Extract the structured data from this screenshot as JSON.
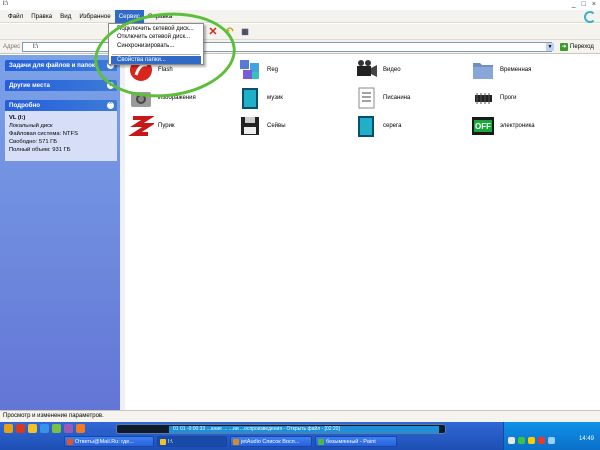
{
  "window": {
    "title": "I:\\"
  },
  "menu": {
    "items": [
      "Файл",
      "Правка",
      "Вид",
      "Избранное",
      "Сервис",
      "Справка"
    ],
    "active": "Сервис"
  },
  "dropdown": {
    "items": [
      "Подключить сетевой диск...",
      "Отключить сетевой диск...",
      "Синхронизировать..."
    ],
    "selected": "Свойства папки..."
  },
  "address": {
    "label": "Адрес",
    "value": "I:\\",
    "go_label": "Переход"
  },
  "left_pane": {
    "sections": [
      {
        "title": "Задачи для файлов и папок"
      },
      {
        "title": "Другие места"
      },
      {
        "title": "Подробно"
      }
    ],
    "details": {
      "drive": "VL (I:)",
      "type": "Локальный диск",
      "fs": "Файловая система: NTFS",
      "free": "Свободно: 571 ГБ",
      "total": "Полный объем: 931 ГБ"
    }
  },
  "folders": [
    {
      "name": "Flash",
      "icon": "flash-icon"
    },
    {
      "name": "Reg",
      "icon": "reg-icon"
    },
    {
      "name": "Видео",
      "icon": "video-camera-icon"
    },
    {
      "name": "Временная",
      "icon": "folder-icon"
    },
    {
      "name": "Изображения",
      "icon": "camera-icon"
    },
    {
      "name": "музик",
      "icon": "music-folder-icon"
    },
    {
      "name": "Писанина",
      "icon": "document-icon"
    },
    {
      "name": "Проги",
      "icon": "chip-icon"
    },
    {
      "name": "Пурик",
      "icon": "zigzag-icon"
    },
    {
      "name": "Сейвы",
      "icon": "floppy-icon"
    },
    {
      "name": "серега",
      "icon": "teal-folder-icon"
    },
    {
      "name": "электроника",
      "icon": "off-switch-icon"
    }
  ],
  "status": {
    "text": "Просмотр и изменение параметров."
  },
  "taskbar": {
    "tasks": [
      "Ответы@Mail.Ru: где...",
      "I:\\",
      "jetAudio Список Восп...",
      "безымянный - Paint"
    ],
    "player_text": "01  01  -0:00:33  ...ание ...  ...ии  ...оспроизведения - Открыть файл - [02:20]",
    "clock": "14:49"
  },
  "colors": {
    "left_pane_top": "#7ba2e7",
    "left_pane_bottom": "#6375d6",
    "taskbar": "#245edb",
    "highlight": "#316ac5",
    "annotation_ellipse": "#5cbf3a"
  }
}
